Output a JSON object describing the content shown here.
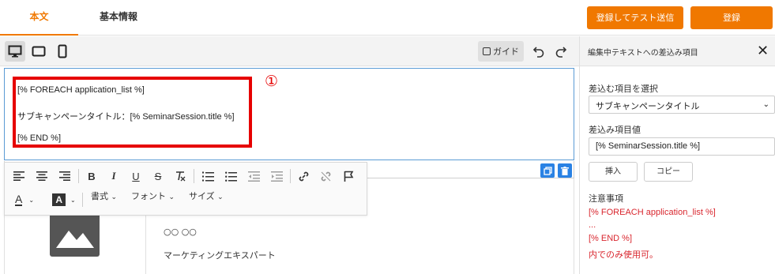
{
  "tabs": [
    {
      "label": "本文",
      "active": true
    },
    {
      "label": "基本情報",
      "active": false
    }
  ],
  "header_buttons": {
    "register_test_label": "登録してテスト送信",
    "register_label": "登録"
  },
  "toolbar": {
    "guide_label": "ガイド",
    "icons": [
      "desktop-icon",
      "tablet-icon",
      "mobile-icon",
      "undo-icon",
      "redo-icon"
    ]
  },
  "editor": {
    "lines": [
      "[% FOREACH application_list %]",
      "サブキャンペーンタイトル：[% SeminarSession.title %]",
      "[% END %]"
    ],
    "annotation": "①",
    "annotation_color": "#e60000"
  },
  "format_toolbar": {
    "style_label": "書式",
    "font_label": "フォント",
    "size_label": "サイズ"
  },
  "content": {
    "name_text": "○○ ○○",
    "role_text": "マーケティングエキスパート"
  },
  "right_panel": {
    "title": "編集中テキストへの差込み項目",
    "select_label": "差込む項目を選択",
    "select_value": "サブキャンペーンタイトル",
    "value_label": "差込み項目値",
    "value_input": "[% SeminarSession.title %]",
    "insert_button": "挿入",
    "copy_button": "コピー",
    "notes_title": "注意事項",
    "notes": [
      "[% FOREACH application_list %]",
      "...",
      "[% END %]",
      "内でのみ使用可。"
    ]
  },
  "colors": {
    "accent": "#f07800",
    "notice": "#d9262e",
    "selection": "#5b9bd5"
  }
}
